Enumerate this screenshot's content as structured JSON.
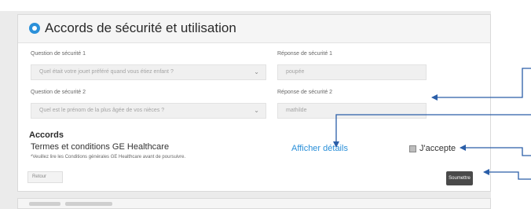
{
  "section": {
    "title": "Accords de sécurité et utilisation",
    "icon": "info-circle-icon",
    "accent_color": "#2b90d9"
  },
  "security": {
    "q1_label": "Question de sécurité 1",
    "q1_value": "Quel était votre jouet préféré quand vous étiez enfant ?",
    "a1_label": "Réponse de sécurité 1",
    "a1_value": "poupée",
    "q2_label": "Question de sécurité 2",
    "q2_value": "Quel est le prénom de la plus âgée de vos nièces ?",
    "a2_label": "Réponse de sécurité 2",
    "a2_value": "mathilde"
  },
  "accords": {
    "heading": "Accords",
    "terms_label": "Termes et conditions GE Healthcare",
    "terms_note": "*Veuillez lire les Conditions générales GE Healthcare avant de poursuivre.",
    "details_link": "Afficher détails",
    "accept_label": "J'accepte",
    "accept_checked": true
  },
  "buttons": {
    "return_label": "Retour",
    "submit_label": "Soumettre",
    "submit_color": "#4a4a4a"
  },
  "annotation_color": "#2a5ea8"
}
